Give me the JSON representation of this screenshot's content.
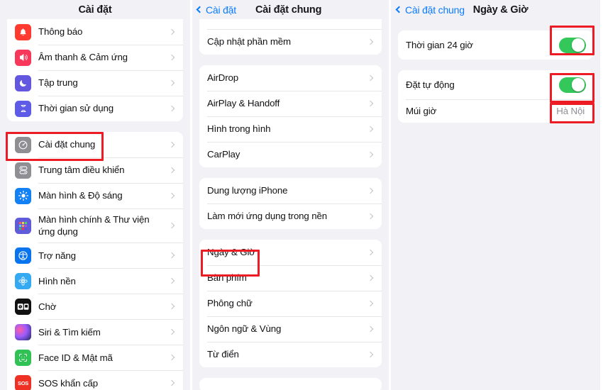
{
  "meta": {
    "accent_blue": "#0a7bff",
    "toggle_green": "#34c759",
    "annotation_red": "#ed1c24",
    "background": "#f2f1f6",
    "card": "#ffffff"
  },
  "panel_settings": {
    "title": "Cài đặt",
    "groups": [
      {
        "items": [
          {
            "label": "Thông báo",
            "icon": "bell-icon",
            "icon_class": "ic-notify"
          },
          {
            "label": "Âm thanh & Cảm ứng",
            "icon": "speaker-icon",
            "icon_class": "ic-sound"
          },
          {
            "label": "Tập trung",
            "icon": "moon-icon",
            "icon_class": "ic-focus"
          },
          {
            "label": "Thời gian sử dụng",
            "icon": "hourglass-icon",
            "icon_class": "ic-screen"
          }
        ]
      },
      {
        "items": [
          {
            "label": "Cài đặt chung",
            "icon": "gear-icon",
            "icon_class": "ic-general",
            "highlighted": true
          },
          {
            "label": "Trung tâm điều khiển",
            "icon": "sliders-icon",
            "icon_class": "ic-control"
          },
          {
            "label": "Màn hình & Độ sáng",
            "icon": "brightness-icon",
            "icon_class": "ic-display"
          },
          {
            "label": "Màn hình chính & Thư viện ứng dụng",
            "icon": "app-grid-icon",
            "icon_class": "ic-home"
          },
          {
            "label": "Trợ năng",
            "icon": "accessibility-icon",
            "icon_class": "ic-access"
          },
          {
            "label": "Hình nền",
            "icon": "flower-icon",
            "icon_class": "ic-wall"
          },
          {
            "label": "Chờ",
            "icon": "standby-icon",
            "icon_class": "ic-standby"
          },
          {
            "label": "Siri & Tìm kiếm",
            "icon": "siri-icon",
            "icon_class": "ic-siri"
          },
          {
            "label": "Face ID & Mật mã",
            "icon": "face-id-icon",
            "icon_class": "ic-faceid"
          },
          {
            "label": "SOS khẩn cấp",
            "icon": "sos-icon",
            "icon_class": "ic-sos",
            "icon_text": "SOS"
          }
        ]
      }
    ]
  },
  "panel_general": {
    "back_label": "Cài đặt",
    "title": "Cài đặt chung",
    "groups": [
      {
        "clipped": true,
        "items": [
          {
            "label": "Cập nhật phần mềm"
          }
        ]
      },
      {
        "items": [
          {
            "label": "AirDrop"
          },
          {
            "label": "AirPlay & Handoff"
          },
          {
            "label": "Hình trong hình"
          },
          {
            "label": "CarPlay"
          }
        ]
      },
      {
        "items": [
          {
            "label": "Dung lượng iPhone"
          },
          {
            "label": "Làm mới ứng dụng trong nền"
          }
        ]
      },
      {
        "items": [
          {
            "label": "Ngày & Giờ",
            "highlighted": true
          },
          {
            "label": "Bàn phím"
          },
          {
            "label": "Phông chữ"
          },
          {
            "label": "Ngôn ngữ & Vùng"
          },
          {
            "label": "Từ điển"
          }
        ]
      }
    ]
  },
  "panel_datetime": {
    "back_label": "Cài đặt chung",
    "title": "Ngày & Giờ",
    "groups": [
      {
        "items": [
          {
            "label": "Thời gian 24 giờ",
            "type": "toggle",
            "value": "on",
            "highlighted": true
          }
        ]
      },
      {
        "items": [
          {
            "label": "Đặt tự động",
            "type": "toggle",
            "value": "on",
            "highlighted": true
          },
          {
            "label": "Múi giờ",
            "type": "value",
            "value": "Hà Nội",
            "highlighted": true
          }
        ]
      }
    ]
  }
}
